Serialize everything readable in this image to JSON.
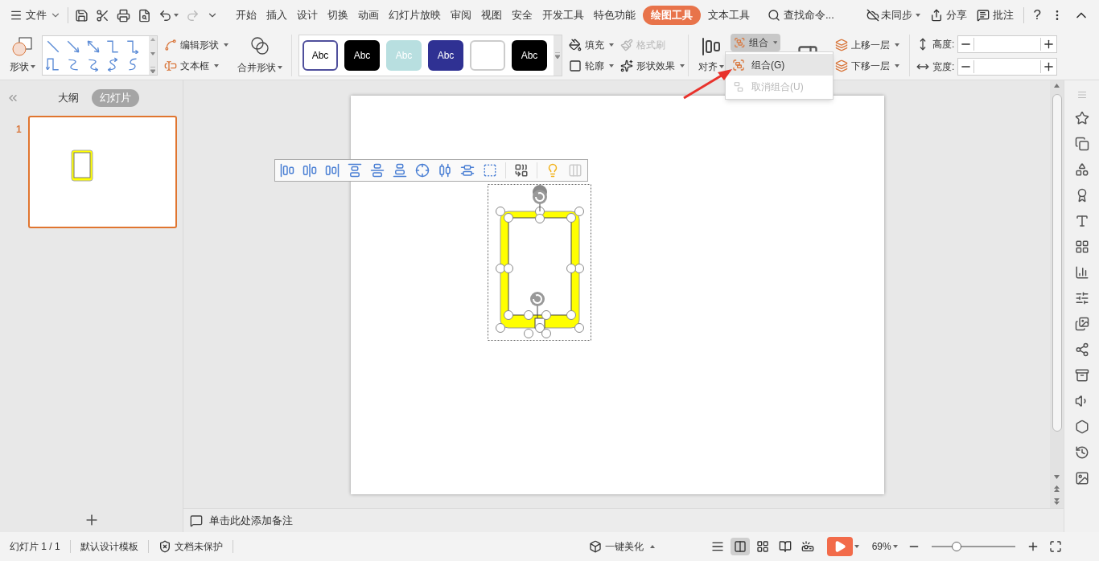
{
  "menu_bar": {
    "file": "文件",
    "tabs": [
      {
        "label": "开始",
        "selected": false
      },
      {
        "label": "插入",
        "selected": false
      },
      {
        "label": "设计",
        "selected": false
      },
      {
        "label": "切换",
        "selected": false
      },
      {
        "label": "动画",
        "selected": false
      },
      {
        "label": "幻灯片放映",
        "selected": false
      },
      {
        "label": "审阅",
        "selected": false
      },
      {
        "label": "视图",
        "selected": false
      },
      {
        "label": "安全",
        "selected": false
      },
      {
        "label": "开发工具",
        "selected": false
      },
      {
        "label": "特色功能",
        "selected": false
      },
      {
        "label": "绘图工具",
        "selected": true
      },
      {
        "label": "文本工具",
        "selected": false
      }
    ],
    "search": {
      "placeholder": "查找命令..."
    },
    "sync": "未同步",
    "share": "分享",
    "comment": "批注",
    "help": "?"
  },
  "ribbon": {
    "shape": "形状",
    "edit_shape": "编辑形状",
    "text_box": "文本框",
    "merge_shapes": "合并形状",
    "styles": [
      {
        "label": "Abc",
        "color": "#ffffff"
      },
      {
        "label": "Abc",
        "color": "#000000"
      },
      {
        "label": "Abc",
        "color": "#b8dfe0"
      },
      {
        "label": "Abc",
        "color": "#2f3193"
      },
      {
        "color": "#ffffff"
      },
      {
        "label": "Abc",
        "color": "#000000"
      }
    ],
    "fill": "填充",
    "format_painter": {
      "label": "格式刷",
      "disabled": true
    },
    "outline": "轮廓",
    "shape_effects": "形状效果",
    "align": "对齐",
    "group": {
      "label": "组合",
      "expanded": true
    },
    "bring_forward": "上移一层",
    "send_backward": "下移一层",
    "height_label": "高度:",
    "width_label": "宽度:"
  },
  "group_menu": [
    {
      "label": "组合(G)",
      "disabled": false,
      "selected": true
    },
    {
      "label": "取消组合(U)",
      "disabled": true,
      "selected": false
    }
  ],
  "left_panel": {
    "tabs": [
      {
        "label": "大纲",
        "selected": false
      },
      {
        "label": "幻灯片",
        "selected": true
      }
    ],
    "slides": [
      {
        "number": "1",
        "selected": true
      }
    ]
  },
  "notes": {
    "placeholder": "单击此处添加备注"
  },
  "status_bar": {
    "slide": "幻灯片 1 / 1",
    "template": "默认设计模板",
    "protection": "文档未保护",
    "beautify": "一键美化",
    "views": [
      {
        "kind": "normal",
        "selected": true
      },
      {
        "kind": "sorter",
        "selected": false
      },
      {
        "kind": "reading",
        "selected": false
      },
      {
        "kind": "presenter",
        "selected": false
      }
    ],
    "zoom": "69%",
    "zoom_slider": {
      "level": 0.3
    }
  }
}
